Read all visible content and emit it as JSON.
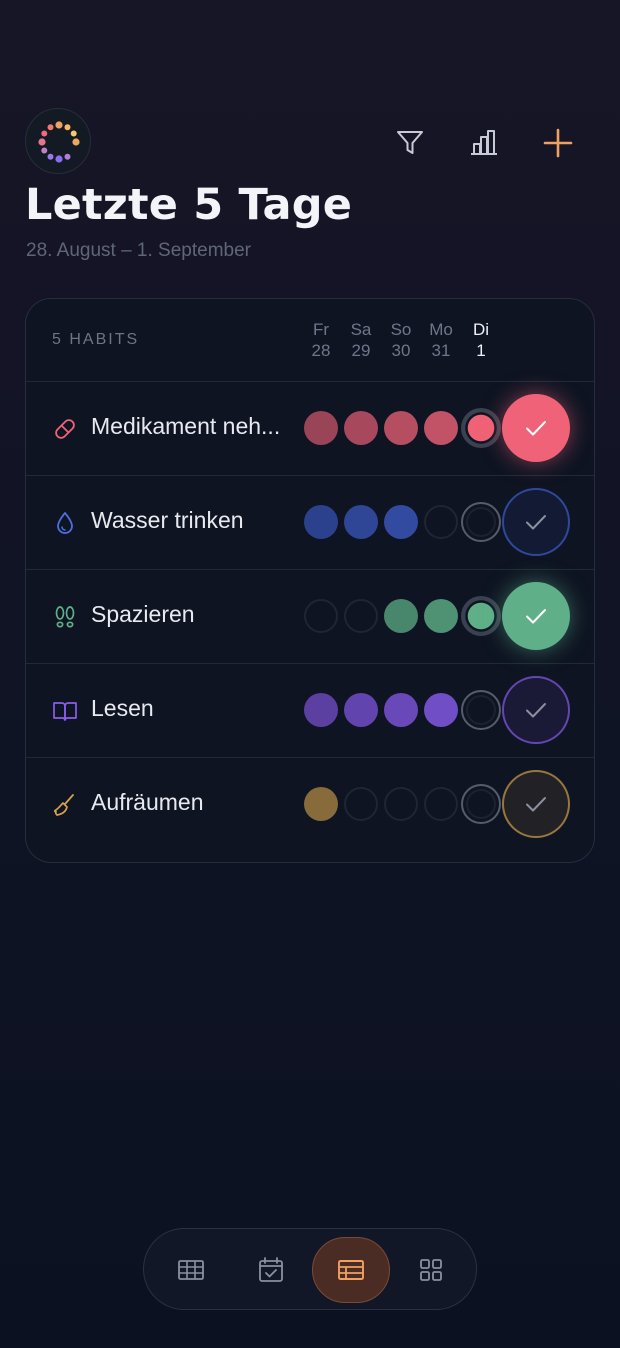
{
  "header": {
    "title": "Letzte 5 Tage",
    "subtitle": "28. August – 1. September",
    "actions": [
      "filter-icon",
      "stats-icon",
      "plus-icon"
    ],
    "accent": "#f0a060"
  },
  "card": {
    "habits_label": "5 HABITS",
    "days": [
      {
        "name": "Fr",
        "date": "28"
      },
      {
        "name": "Sa",
        "date": "29"
      },
      {
        "name": "So",
        "date": "30"
      },
      {
        "name": "Mo",
        "date": "31"
      },
      {
        "name": "Di",
        "date": "1",
        "today": true
      }
    ],
    "habits": [
      {
        "name": "Medikament neh...",
        "icon": "pill-icon",
        "color": "#f06277",
        "days": [
          true,
          true,
          true,
          true,
          true
        ],
        "done_today": true
      },
      {
        "name": "Wasser trinken",
        "icon": "water-drop-icon",
        "color": "#3f5ecf",
        "days": [
          true,
          true,
          true,
          false,
          false
        ],
        "done_today": false
      },
      {
        "name": "Spazieren",
        "icon": "footsteps-icon",
        "color": "#5fb088",
        "days": [
          false,
          false,
          true,
          true,
          true
        ],
        "done_today": true
      },
      {
        "name": "Lesen",
        "icon": "book-icon",
        "color": "#8a5cf0",
        "days": [
          true,
          true,
          true,
          true,
          false
        ],
        "done_today": false
      },
      {
        "name": "Aufräumen",
        "icon": "broom-icon",
        "color": "#d3a24b",
        "days": [
          true,
          false,
          false,
          false,
          false
        ],
        "done_today": false
      }
    ]
  },
  "bottom_nav": {
    "items": [
      "grid-view-icon",
      "calendar-check-icon",
      "list-view-icon",
      "dashboard-icon"
    ],
    "active": 2
  }
}
